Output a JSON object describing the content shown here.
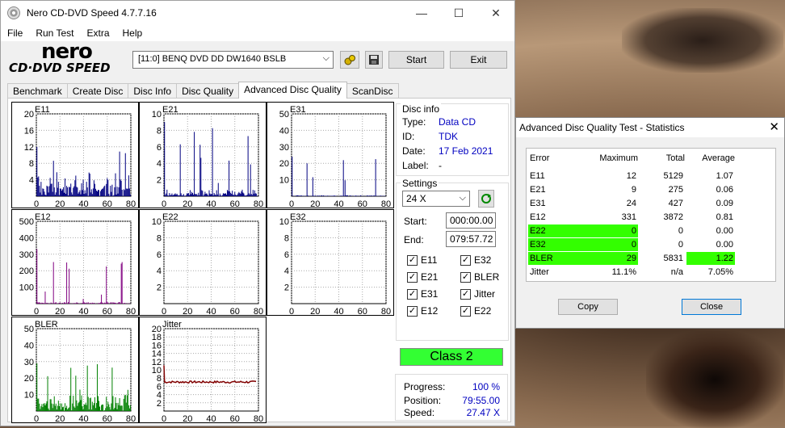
{
  "main_window": {
    "title": "Nero CD-DVD Speed 4.7.7.16",
    "controls": {
      "minimize": "—",
      "maximize": "☐",
      "close": "✕"
    },
    "menu": [
      "File",
      "Run Test",
      "Extra",
      "Help"
    ],
    "logo": {
      "word1": "nero",
      "word2": "CD·DVD SPEED"
    },
    "drive": "[11:0]   BENQ DVD DD DW1640 BSLB",
    "start_label": "Start",
    "exit_label": "Exit",
    "tabs": [
      "Benchmark",
      "Create Disc",
      "Disc Info",
      "Disc Quality",
      "Advanced Disc Quality",
      "ScanDisc"
    ],
    "active_tab": "Advanced Disc Quality"
  },
  "disc_info": {
    "heading": "Disc info",
    "type_label": "Type:",
    "type": "Data CD",
    "id_label": "ID:",
    "id": "TDK",
    "date_label": "Date:",
    "date": "17 Feb 2021",
    "label_label": "Label:",
    "label": "-"
  },
  "settings": {
    "heading": "Settings",
    "speed": "24 X",
    "start_label": "Start:",
    "start": "000:00.00",
    "end_label": "End:",
    "end": "079:57.72",
    "checks": [
      {
        "label": "E11",
        "checked": true
      },
      {
        "label": "E32",
        "checked": true
      },
      {
        "label": "E21",
        "checked": true
      },
      {
        "label": "BLER",
        "checked": true
      },
      {
        "label": "E31",
        "checked": true
      },
      {
        "label": "Jitter",
        "checked": true
      },
      {
        "label": "E12",
        "checked": true
      },
      {
        "label": "E22",
        "checked": true
      }
    ]
  },
  "class_label": "Class 2",
  "progress": {
    "progress_label": "Progress:",
    "progress": "100 %",
    "position_label": "Position:",
    "position": "79:55.00",
    "speed_label": "Speed:",
    "speed": "27.47 X"
  },
  "stats_window": {
    "title": "Advanced Disc Quality Test - Statistics",
    "close": "✕",
    "headers": [
      "Error",
      "Maximum",
      "Total",
      "Average"
    ],
    "rows": [
      {
        "error": "E11",
        "maximum": "12",
        "total": "5129",
        "average": "1.07",
        "hl_max": false,
        "hl_avg": false
      },
      {
        "error": "E21",
        "maximum": "9",
        "total": "275",
        "average": "0.06",
        "hl_max": false,
        "hl_avg": false
      },
      {
        "error": "E31",
        "maximum": "24",
        "total": "427",
        "average": "0.09",
        "hl_max": false,
        "hl_avg": false
      },
      {
        "error": "E12",
        "maximum": "331",
        "total": "3872",
        "average": "0.81",
        "hl_max": false,
        "hl_avg": false
      },
      {
        "error": "E22",
        "maximum": "0",
        "total": "0",
        "average": "0.00",
        "hl_max": true,
        "hl_avg": false
      },
      {
        "error": "E32",
        "maximum": "0",
        "total": "0",
        "average": "0.00",
        "hl_max": true,
        "hl_avg": false
      },
      {
        "error": "BLER",
        "maximum": "29",
        "total": "5831",
        "average": "1.22",
        "hl_max": true,
        "hl_avg": true
      },
      {
        "error": "Jitter",
        "maximum": "11.1%",
        "total": "n/a",
        "average": "7.05%",
        "hl_max": false,
        "hl_avg": false
      }
    ],
    "copy_label": "Copy",
    "close_label": "Close"
  },
  "colors": {
    "highlight": "#33ff00",
    "navy": "#000080",
    "purple": "#800080",
    "green": "#008000",
    "maroon": "#800000"
  },
  "chart_data": [
    {
      "type": "bar",
      "title": "E11",
      "xlim": [
        0,
        80
      ],
      "ylim": [
        0,
        20
      ],
      "yticks": [
        4,
        8,
        12,
        16,
        20
      ],
      "xticks": [
        0,
        20,
        40,
        60,
        80
      ],
      "color": "#000080",
      "seed": 11,
      "base": 3,
      "peak": 12
    },
    {
      "type": "bar",
      "title": "E21",
      "xlim": [
        0,
        80
      ],
      "ylim": [
        0,
        10
      ],
      "yticks": [
        2,
        4,
        6,
        8,
        10
      ],
      "xticks": [
        0,
        20,
        40,
        60,
        80
      ],
      "color": "#000080",
      "seed": 21,
      "base": 0.4,
      "peak": 9
    },
    {
      "type": "bar",
      "title": "E31",
      "xlim": [
        0,
        80
      ],
      "ylim": [
        0,
        50
      ],
      "yticks": [
        10,
        20,
        30,
        40,
        50
      ],
      "xticks": [
        0,
        20,
        40,
        60,
        80
      ],
      "color": "#000080",
      "seed": 31,
      "base": 0.3,
      "peak": 24
    },
    {
      "type": "bar",
      "title": "E12",
      "xlim": [
        0,
        80
      ],
      "ylim": [
        0,
        500
      ],
      "yticks": [
        100,
        200,
        300,
        400,
        500
      ],
      "xticks": [
        0,
        20,
        40,
        60,
        80
      ],
      "color": "#800080",
      "seed": 12,
      "base": 5,
      "peak": 331
    },
    {
      "type": "bar",
      "title": "E22",
      "xlim": [
        0,
        80
      ],
      "ylim": [
        0,
        10
      ],
      "yticks": [
        2,
        4,
        6,
        8,
        10
      ],
      "xticks": [
        0,
        20,
        40,
        60,
        80
      ],
      "color": "#800080",
      "seed": 22,
      "base": 0,
      "peak": 0
    },
    {
      "type": "bar",
      "title": "E32",
      "xlim": [
        0,
        80
      ],
      "ylim": [
        0,
        10
      ],
      "yticks": [
        2,
        4,
        6,
        8,
        10
      ],
      "xticks": [
        0,
        20,
        40,
        60,
        80
      ],
      "color": "#800080",
      "seed": 32,
      "base": 0,
      "peak": 0
    },
    {
      "type": "bar",
      "title": "BLER",
      "xlim": [
        0,
        80
      ],
      "ylim": [
        0,
        50
      ],
      "yticks": [
        10,
        20,
        30,
        40,
        50
      ],
      "xticks": [
        0,
        20,
        40,
        60,
        80
      ],
      "color": "#008000",
      "seed": 99,
      "base": 5,
      "peak": 29
    },
    {
      "type": "line",
      "title": "Jitter",
      "xlim": [
        0,
        80
      ],
      "ylim": [
        0,
        20
      ],
      "yticks": [
        2,
        4,
        6,
        8,
        10,
        12,
        14,
        16,
        18,
        20
      ],
      "xticks": [
        0,
        20,
        40,
        60,
        80
      ],
      "color": "#800000",
      "seed": 7,
      "base": 7.05,
      "peak": 11.1
    }
  ]
}
